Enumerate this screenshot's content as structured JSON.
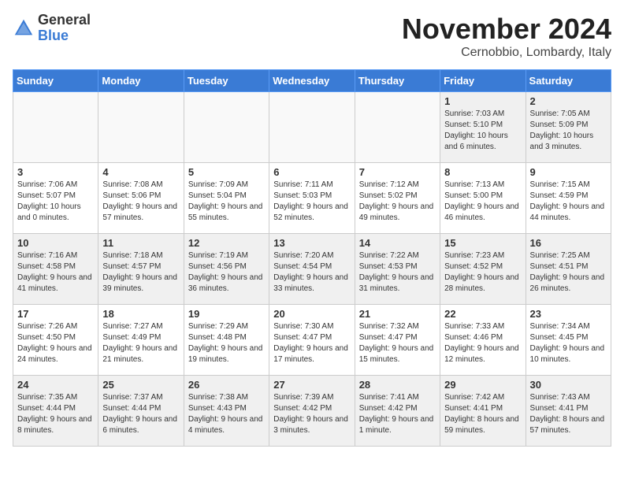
{
  "logo": {
    "general": "General",
    "blue": "Blue"
  },
  "title": "November 2024",
  "location": "Cernobbio, Lombardy, Italy",
  "weekdays": [
    "Sunday",
    "Monday",
    "Tuesday",
    "Wednesday",
    "Thursday",
    "Friday",
    "Saturday"
  ],
  "weeks": [
    [
      {
        "day": "",
        "info": ""
      },
      {
        "day": "",
        "info": ""
      },
      {
        "day": "",
        "info": ""
      },
      {
        "day": "",
        "info": ""
      },
      {
        "day": "",
        "info": ""
      },
      {
        "day": "1",
        "info": "Sunrise: 7:03 AM\nSunset: 5:10 PM\nDaylight: 10 hours\nand 6 minutes."
      },
      {
        "day": "2",
        "info": "Sunrise: 7:05 AM\nSunset: 5:09 PM\nDaylight: 10 hours\nand 3 minutes."
      }
    ],
    [
      {
        "day": "3",
        "info": "Sunrise: 7:06 AM\nSunset: 5:07 PM\nDaylight: 10 hours\nand 0 minutes."
      },
      {
        "day": "4",
        "info": "Sunrise: 7:08 AM\nSunset: 5:06 PM\nDaylight: 9 hours\nand 57 minutes."
      },
      {
        "day": "5",
        "info": "Sunrise: 7:09 AM\nSunset: 5:04 PM\nDaylight: 9 hours\nand 55 minutes."
      },
      {
        "day": "6",
        "info": "Sunrise: 7:11 AM\nSunset: 5:03 PM\nDaylight: 9 hours\nand 52 minutes."
      },
      {
        "day": "7",
        "info": "Sunrise: 7:12 AM\nSunset: 5:02 PM\nDaylight: 9 hours\nand 49 minutes."
      },
      {
        "day": "8",
        "info": "Sunrise: 7:13 AM\nSunset: 5:00 PM\nDaylight: 9 hours\nand 46 minutes."
      },
      {
        "day": "9",
        "info": "Sunrise: 7:15 AM\nSunset: 4:59 PM\nDaylight: 9 hours\nand 44 minutes."
      }
    ],
    [
      {
        "day": "10",
        "info": "Sunrise: 7:16 AM\nSunset: 4:58 PM\nDaylight: 9 hours\nand 41 minutes."
      },
      {
        "day": "11",
        "info": "Sunrise: 7:18 AM\nSunset: 4:57 PM\nDaylight: 9 hours\nand 39 minutes."
      },
      {
        "day": "12",
        "info": "Sunrise: 7:19 AM\nSunset: 4:56 PM\nDaylight: 9 hours\nand 36 minutes."
      },
      {
        "day": "13",
        "info": "Sunrise: 7:20 AM\nSunset: 4:54 PM\nDaylight: 9 hours\nand 33 minutes."
      },
      {
        "day": "14",
        "info": "Sunrise: 7:22 AM\nSunset: 4:53 PM\nDaylight: 9 hours\nand 31 minutes."
      },
      {
        "day": "15",
        "info": "Sunrise: 7:23 AM\nSunset: 4:52 PM\nDaylight: 9 hours\nand 28 minutes."
      },
      {
        "day": "16",
        "info": "Sunrise: 7:25 AM\nSunset: 4:51 PM\nDaylight: 9 hours\nand 26 minutes."
      }
    ],
    [
      {
        "day": "17",
        "info": "Sunrise: 7:26 AM\nSunset: 4:50 PM\nDaylight: 9 hours\nand 24 minutes."
      },
      {
        "day": "18",
        "info": "Sunrise: 7:27 AM\nSunset: 4:49 PM\nDaylight: 9 hours\nand 21 minutes."
      },
      {
        "day": "19",
        "info": "Sunrise: 7:29 AM\nSunset: 4:48 PM\nDaylight: 9 hours\nand 19 minutes."
      },
      {
        "day": "20",
        "info": "Sunrise: 7:30 AM\nSunset: 4:47 PM\nDaylight: 9 hours\nand 17 minutes."
      },
      {
        "day": "21",
        "info": "Sunrise: 7:32 AM\nSunset: 4:47 PM\nDaylight: 9 hours\nand 15 minutes."
      },
      {
        "day": "22",
        "info": "Sunrise: 7:33 AM\nSunset: 4:46 PM\nDaylight: 9 hours\nand 12 minutes."
      },
      {
        "day": "23",
        "info": "Sunrise: 7:34 AM\nSunset: 4:45 PM\nDaylight: 9 hours\nand 10 minutes."
      }
    ],
    [
      {
        "day": "24",
        "info": "Sunrise: 7:35 AM\nSunset: 4:44 PM\nDaylight: 9 hours\nand 8 minutes."
      },
      {
        "day": "25",
        "info": "Sunrise: 7:37 AM\nSunset: 4:44 PM\nDaylight: 9 hours\nand 6 minutes."
      },
      {
        "day": "26",
        "info": "Sunrise: 7:38 AM\nSunset: 4:43 PM\nDaylight: 9 hours\nand 4 minutes."
      },
      {
        "day": "27",
        "info": "Sunrise: 7:39 AM\nSunset: 4:42 PM\nDaylight: 9 hours\nand 3 minutes."
      },
      {
        "day": "28",
        "info": "Sunrise: 7:41 AM\nSunset: 4:42 PM\nDaylight: 9 hours\nand 1 minute."
      },
      {
        "day": "29",
        "info": "Sunrise: 7:42 AM\nSunset: 4:41 PM\nDaylight: 8 hours\nand 59 minutes."
      },
      {
        "day": "30",
        "info": "Sunrise: 7:43 AM\nSunset: 4:41 PM\nDaylight: 8 hours\nand 57 minutes."
      }
    ]
  ]
}
